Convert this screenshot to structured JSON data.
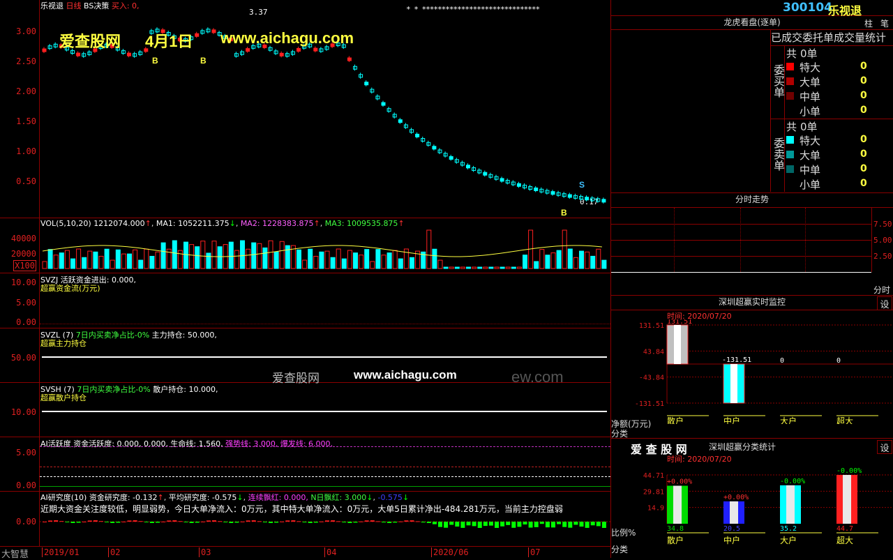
{
  "header": {
    "stock_name": "乐视退",
    "period": "日线",
    "strategy": "BS决策",
    "buy_label": "买入: 0,",
    "code": "300104",
    "name": "乐视退",
    "btn_zhu": "柱",
    "btn_bi": "笔",
    "top_markers": "* * ******************************",
    "price_high_label": "3.37",
    "price_last_label": "0.17"
  },
  "watermark": {
    "site": "爱查股网",
    "date": "4月1日",
    "url": "www.aichagu.com",
    "site2": "爱查股网",
    "url2": "www.aichagu.com",
    "ghost": "ew.com"
  },
  "price_axis": [
    "3.00",
    "2.50",
    "2.00",
    "1.50",
    "1.00",
    "0.50"
  ],
  "signals": {
    "buy": "B",
    "sell": "S"
  },
  "vol": {
    "title": "VOL(5,10,20)",
    "val": "1212074.000",
    "ma1": "MA1: 1052211.375",
    "ma2": "MA2: 1228383.875",
    "ma3": "MA3: 1009535.875",
    "axis": [
      "40000",
      "20000"
    ],
    "unit": "X100"
  },
  "svzj": {
    "title": "SVZJ  活跃资金进出: 0.000,",
    "sub": "超赢资金流(万元)",
    "axis": [
      "10.00",
      "5.00",
      "0.00"
    ]
  },
  "svzl": {
    "title": "SVZL (7)",
    "green": "7日内买卖净占比-0%",
    "rest": "主力持仓: 50.000,",
    "sub": "超赢主力持仓",
    "axis": [
      "50.00"
    ]
  },
  "svsh": {
    "title": "SVSH (7)",
    "green": "7日内买卖净占比-0%",
    "rest": "散户持仓: 10.000,",
    "sub": "超赢散户持仓",
    "axis": [
      "10.00"
    ]
  },
  "ai_active": {
    "title": "AI活跃度 资金活跃度: 0.000, 0.000, 生命线: 1.560,",
    "strong": "强势线: 3.000,",
    "burst": "爆发线: 6.000,",
    "axis": [
      "5.00",
      "0.00"
    ]
  },
  "ai_research": {
    "title": "AI研究度(10) 资金研究度: -0.132",
    "avg": "平均研究度: -0.575",
    "red": "连续飘红: 0.000,",
    "nred": "N日飘红: 3.000",
    "neg": "-0.575",
    "desc": "近期大资金关注度较低，明显弱势，今日大单净流入：0万元，其中特大单净流入：0万元，大单5日累计净出-484.281万元，当前主力控盘弱",
    "axis": [
      "0.00"
    ]
  },
  "date_axis": [
    "2019/01",
    "02",
    "03",
    "04",
    "2020/06",
    "07"
  ],
  "brand": "大智慧",
  "dragon": {
    "title": "龙虎看盘(逐单)",
    "subtitle": "已成交委托单成交量统计",
    "buy_label": "委买单",
    "sell_label": "委卖单",
    "buy": {
      "total_label": "共",
      "total": "0单",
      "rows": [
        {
          "name": "特大",
          "value": "0",
          "color": "#ff0000"
        },
        {
          "name": "大单",
          "value": "0",
          "color": "#b00000"
        },
        {
          "name": "中单",
          "value": "0",
          "color": "#700000"
        },
        {
          "name": "小单",
          "value": "0",
          "color": "#000000"
        }
      ]
    },
    "sell": {
      "total_label": "共",
      "total": "0单",
      "rows": [
        {
          "name": "特大",
          "value": "0",
          "color": "#00ffff"
        },
        {
          "name": "大单",
          "value": "0",
          "color": "#009999"
        },
        {
          "name": "中单",
          "value": "0",
          "color": "#006666"
        },
        {
          "name": "小单",
          "value": "0",
          "color": "#000000"
        }
      ]
    }
  },
  "intraday": {
    "title": "分时走势",
    "axis": [
      "7.50",
      "5.00",
      "2.50"
    ],
    "unit": "分时"
  },
  "monitor": {
    "title": "深圳超赢实时监控",
    "time": "时间: 2020/07/20",
    "settings": "设",
    "yaxis": [
      "131.51",
      "43.84",
      "-43.84",
      "-131.51"
    ],
    "yunit": "净额(万元)",
    "xlabel": "分类",
    "bar_labels": [
      "131.51",
      "-131.51",
      "0",
      "0"
    ],
    "categories": [
      "散户",
      "中户",
      "大户",
      "超大"
    ]
  },
  "classify": {
    "brand": "爱 查 股 网",
    "title": "深圳超赢分类统计",
    "time": "时间: 2020/07/20",
    "settings": "设",
    "yaxis": [
      "44.71",
      "29.81",
      "14.9"
    ],
    "yunit": "比例%",
    "xlabel": "分类",
    "pct_labels": [
      "+0.00%",
      "+0.00%",
      "-0.00%",
      "-0.00%"
    ],
    "values_text": [
      "34.8",
      "20.5",
      "35.2",
      "44.7"
    ],
    "categories": [
      "散户",
      "中户",
      "大户",
      "超大"
    ]
  },
  "chart_data": [
    {
      "type": "bar",
      "title": "深圳超赢实时监控",
      "ylabel": "净额(万元)",
      "categories": [
        "散户",
        "中户",
        "大户",
        "超大"
      ],
      "values": [
        131.51,
        -131.51,
        0,
        0
      ],
      "ylim": [
        -131.51,
        131.51
      ]
    },
    {
      "type": "bar",
      "title": "深圳超赢分类统计",
      "ylabel": "比例%",
      "categories": [
        "散户",
        "中户",
        "大户",
        "超大"
      ],
      "values": [
        34.8,
        20.5,
        35.2,
        44.7
      ],
      "ylim": [
        0,
        44.71
      ]
    }
  ],
  "colors": {
    "grid": "#8b0000",
    "axis_text": "#e02020",
    "cyan": "#00ffff",
    "yellow": "#ffff00",
    "white": "#ffffff",
    "red": "#ff2020",
    "green": "#00ff00",
    "magenta": "#ff40ff"
  }
}
